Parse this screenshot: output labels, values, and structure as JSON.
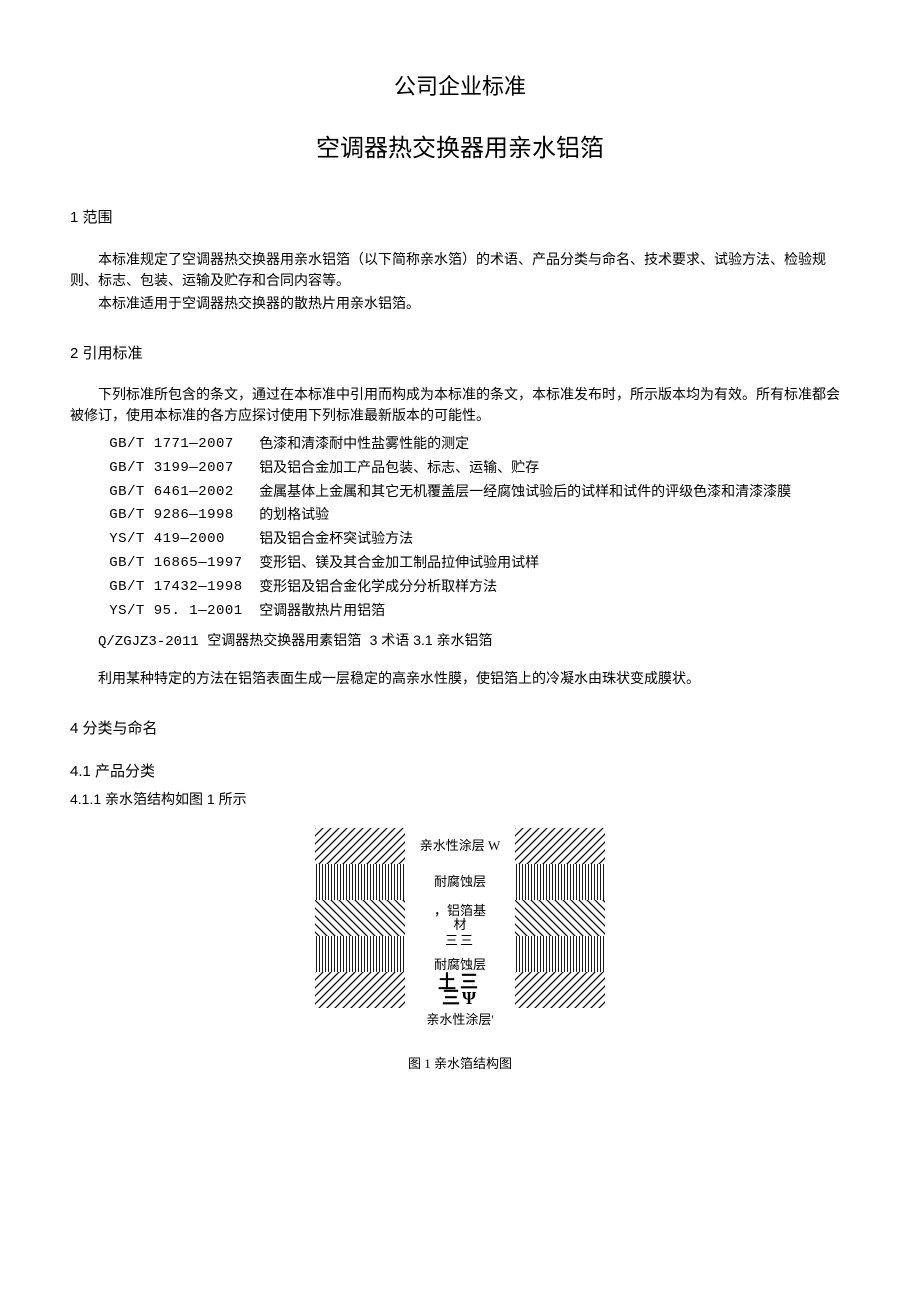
{
  "title1": "公司企业标准",
  "title2": "空调器热交换器用亲水铝箔",
  "sec1_head": "1 范围",
  "sec1_p1": "本标准规定了空调器热交换器用亲水铝箔（以下简称亲水箔）的术语、产品分类与命名、技术要求、试验方法、检验规则、标志、包装、运输及贮存和合同内容等。",
  "sec1_p2": "本标准适用于空调器热交换器的散热片用亲水铝箔。",
  "sec2_head": "2 引用标准",
  "sec2_p1": "下列标准所包含的条文，通过在本标准中引用而构成为本标准的条文，本标准发布时，所示版本均为有效。所有标准都会被修订，使用本标准的各方应探讨使用下列标准最新版本的可能性。",
  "standards": [
    {
      "code": "GB/T 1771—2007",
      "title": "色漆和清漆耐中性盐雾性能的测定"
    },
    {
      "code": "GB/T 3199—2007",
      "title": "铝及铝合金加工产品包装、标志、运输、贮存"
    },
    {
      "code": "GB/T 6461—2002",
      "title": "金属基体上金属和其它无机覆盖层一经腐蚀试验后的试样和试件的评级色漆和清漆漆膜"
    },
    {
      "code": "GB/T 9286—1998",
      "title": "的划格试验"
    },
    {
      "code": "YS/T 419—2000",
      "title": "铝及铝合金杯突试验方法"
    },
    {
      "code": "GB/T 16865—1997",
      "title": "变形铝、镁及其合金加工制品拉伸试验用试样"
    },
    {
      "code": "GB/T 17432—1998",
      "title": "变形铝及铝合金化学成分分析取样方法"
    },
    {
      "code": "YS/T 95. 1—2001",
      "title": "空调器散热片用铝箔"
    }
  ],
  "line3_a": "Q/ZGJZ3-2011 空调器热交换器用素铝箔 ",
  "line3_b": "3 术语 3.1 亲水铝箔",
  "sec3_p1": "利用某种特定的方法在铝箔表面生成一层稳定的高亲水性膜，使铝箔上的冷凝水由珠状变成膜状。",
  "sec4_head": "4 分类与命名",
  "sec4_1_head": "4.1  产品分类",
  "sec4_1_1_head": "4.1.1  亲水箔结构如图 1 所示",
  "fig": {
    "l1": "亲水性涂层 W",
    "l2": "耐腐蚀层",
    "l3a": "，铝箔基",
    "l3b": "材",
    "l4a": "三三",
    "l4b": "耐腐蚀层",
    "l5a": "土三",
    "l5b": "三Ψ",
    "bottom": "亲水性涂层'",
    "caption": "图 1 亲水箔结构图"
  }
}
